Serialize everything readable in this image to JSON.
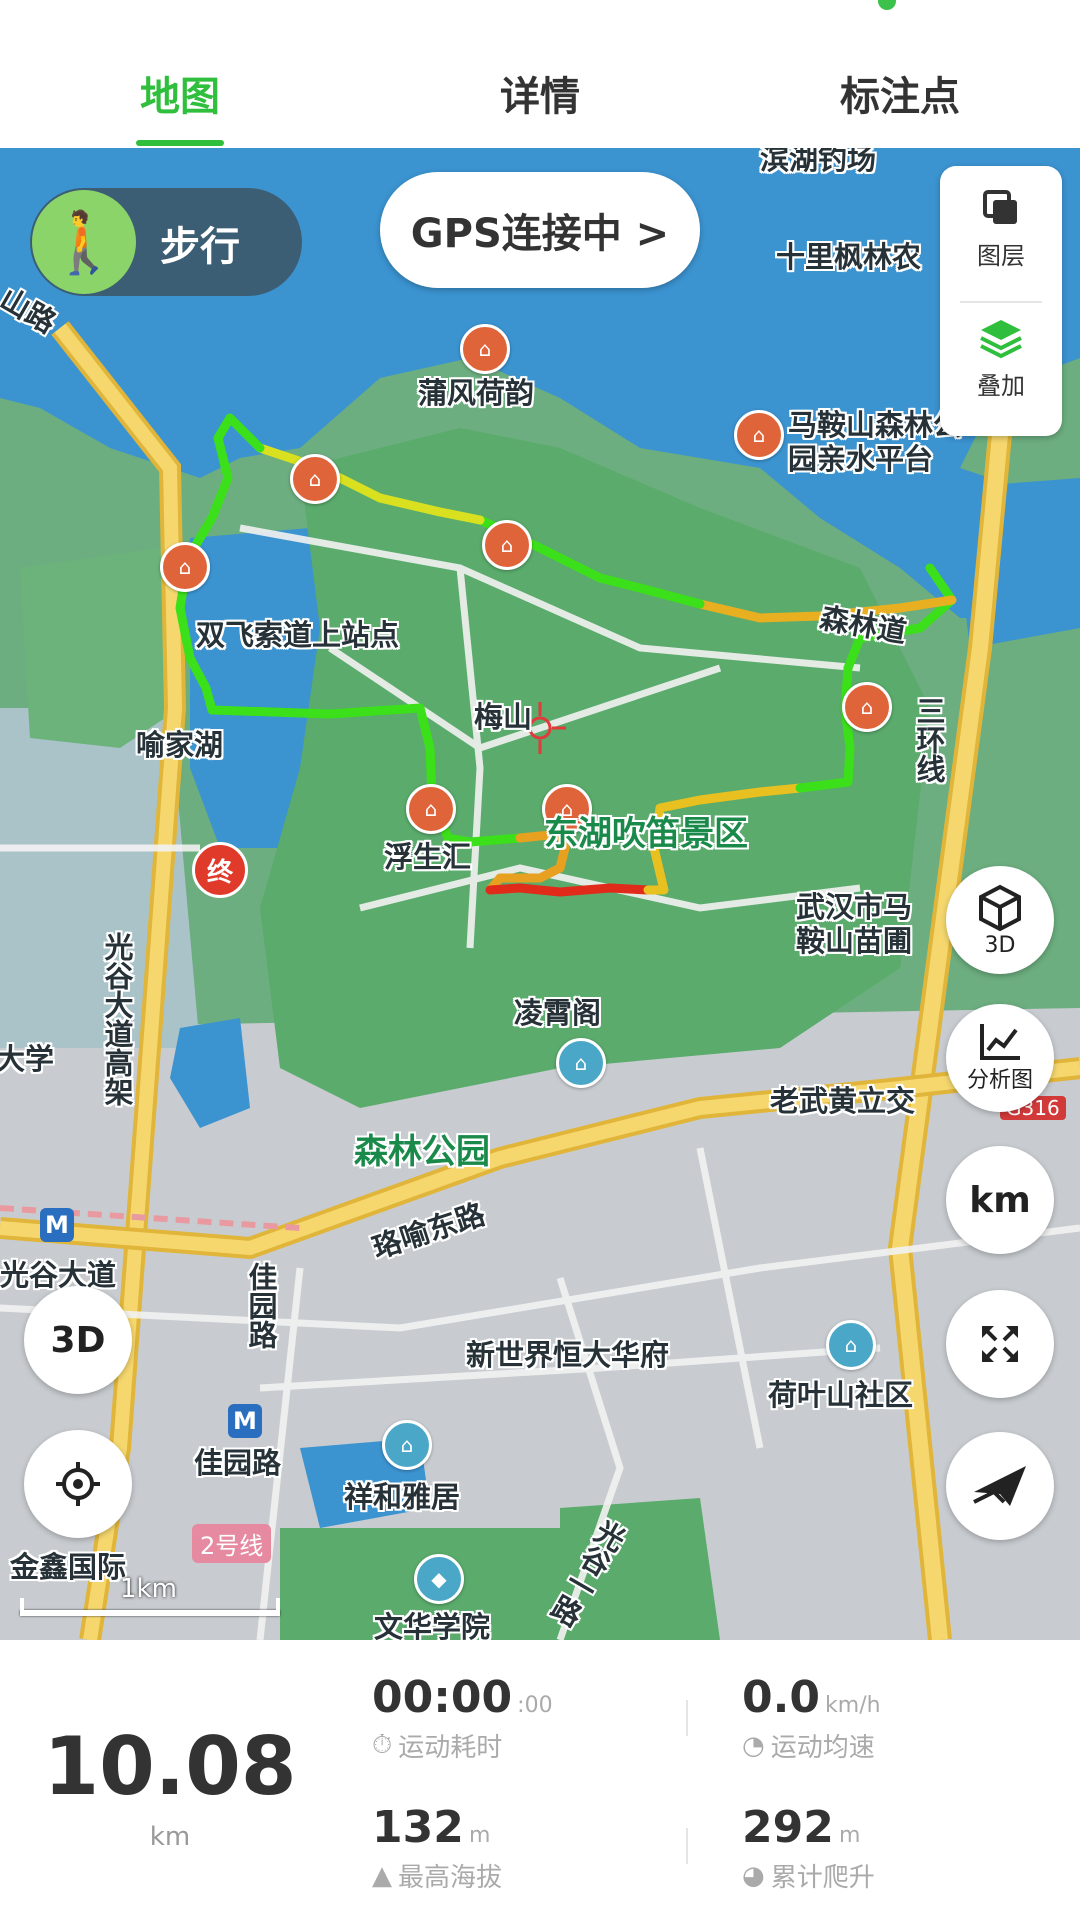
{
  "tabs": [
    {
      "label": "地图",
      "active": true
    },
    {
      "label": "详情",
      "active": false
    },
    {
      "label": "标注点",
      "active": false
    }
  ],
  "map": {
    "mode_label": "步行",
    "mode_icon": "walking-person-icon",
    "gps_status": "GPS连接中 >",
    "layers": {
      "layer_label": "图层",
      "overlay_label": "叠加"
    },
    "end_marker": "终",
    "scale_label": "1km",
    "buttons": {
      "three_d_label": "3D",
      "analysis_label": "分析图",
      "km_label": "km",
      "three_d_left": "3D"
    },
    "labels": {
      "binhu": "滨湖钓场",
      "shili": "十里枫林农",
      "shan_lu": "山路",
      "pufeng": "蒲风荷韵",
      "maanshan": "马鞍山森林公",
      "maanshan2": "园亲水平台",
      "shuangfei": "双飞索道上站点",
      "meishan": "梅山",
      "senlindao": "森林道",
      "yujiahu": "喻家湖",
      "sanhuan": "三环线",
      "scenic": "东湖吹笛景区",
      "fushenghui": "浮生汇",
      "wuhan_miaopu": "武汉市马",
      "wuhan_miaopu2": "鞍山苗圃",
      "guanggu_dadao_gaojia": "光谷大道高架",
      "daxue": "大学",
      "lingxiao": "凌霄阁",
      "laowu": "老武黄立交",
      "g316": "G316",
      "senlin_park": "森林公园",
      "luoyu": "珞喻东路",
      "guanggu_dadao": "光谷大道",
      "jiayuanlu_v": "佳园路",
      "xinshijie": "新世界恒大华府",
      "heyeshan": "荷叶山社区",
      "jiayuanlu": "佳园路",
      "xianghe": "祥和雅居",
      "line2": "2号线",
      "jinxin": "金鑫国际",
      "guanggu_yilu": "光谷一路",
      "wenhua": "文华学院"
    },
    "route_colors": {
      "fast": "#3be01a",
      "mid": "#e8d020",
      "slow": "#e02a1a"
    }
  },
  "stats": {
    "distance": "10.08",
    "distance_unit": "km",
    "duration_main": "00:00",
    "duration_sec": ":00",
    "duration_label": "运动耗时",
    "avg_speed": "0.0",
    "avg_speed_unit": "km/h",
    "avg_speed_label": "运动均速",
    "max_alt": "132",
    "max_alt_unit": "m",
    "max_alt_label": "最高海拔",
    "climb": "292",
    "climb_unit": "m",
    "climb_label": "累计爬升"
  }
}
